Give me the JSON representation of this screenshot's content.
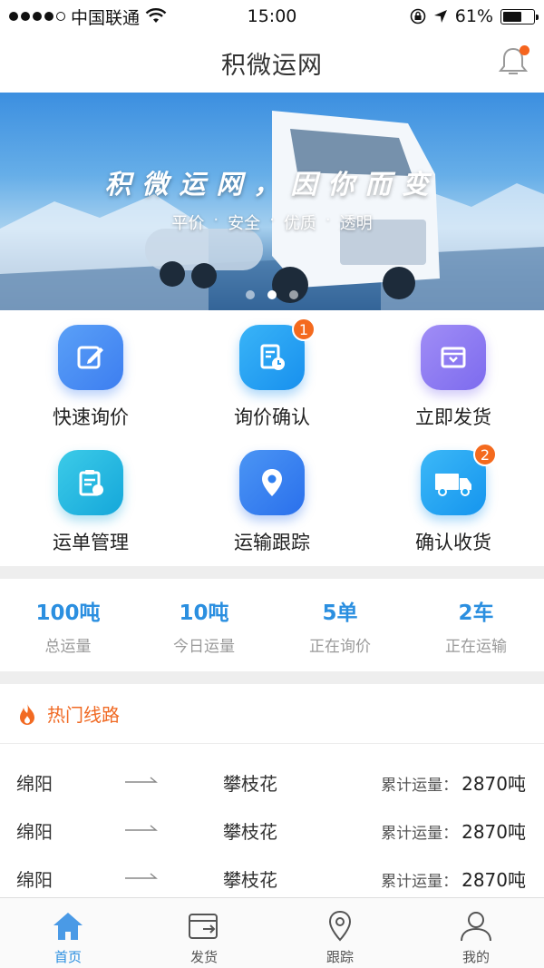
{
  "status_bar": {
    "carrier": "中国联通",
    "time": "15:00",
    "battery": "61%",
    "battery_level": 0.61
  },
  "header": {
    "title": "积微运网"
  },
  "banner": {
    "slogan": "积微运网，因你而变",
    "tags": [
      "平价",
      "安全",
      "优质",
      "透明"
    ],
    "slides": 3,
    "active_slide": 2
  },
  "menu": [
    {
      "label": "快速询价",
      "icon": "edit-icon",
      "badge": null,
      "color": "#3d8cf0"
    },
    {
      "label": "询价确认",
      "icon": "document-clock-icon",
      "badge": "1",
      "color": "#1e9bf0"
    },
    {
      "label": "立即发货",
      "icon": "package-icon",
      "badge": null,
      "color": "#8a7cf0"
    },
    {
      "label": "运单管理",
      "icon": "clipboard-icon",
      "badge": null,
      "color": "#1fb6e6"
    },
    {
      "label": "运输跟踪",
      "icon": "location-pin-icon",
      "badge": null,
      "color": "#2f7ff0"
    },
    {
      "label": "确认收货",
      "icon": "truck-icon",
      "badge": "2",
      "color": "#1ea6f2"
    }
  ],
  "stats": [
    {
      "value": "100吨",
      "label": "总运量"
    },
    {
      "value": "10吨",
      "label": "今日运量"
    },
    {
      "value": "5单",
      "label": "正在询价"
    },
    {
      "value": "2车",
      "label": "正在运输"
    }
  ],
  "hot_routes": {
    "title": "热门线路",
    "rows": [
      {
        "from": "绵阳",
        "to": "攀枝花",
        "total_label": "累计运量：",
        "total_value": "2870吨"
      },
      {
        "from": "绵阳",
        "to": "攀枝花",
        "total_label": "累计运量：",
        "total_value": "2870吨"
      },
      {
        "from": "绵阳",
        "to": "攀枝花",
        "total_label": "累计运量：",
        "total_value": "2870吨"
      }
    ]
  },
  "tabbar": [
    {
      "label": "首页",
      "icon": "home-icon",
      "active": true
    },
    {
      "label": "发货",
      "icon": "ship-box-icon",
      "active": false
    },
    {
      "label": "跟踪",
      "icon": "location-pin-icon",
      "active": false
    },
    {
      "label": "我的",
      "icon": "user-icon",
      "active": false
    }
  ]
}
